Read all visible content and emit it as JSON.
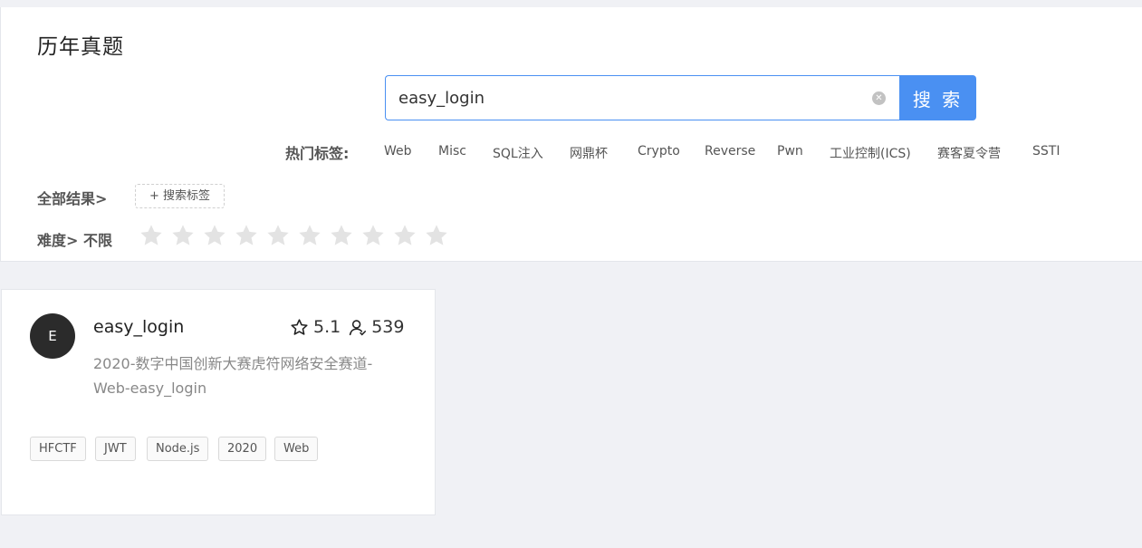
{
  "page": {
    "title": "历年真题"
  },
  "search": {
    "value": "easy_login",
    "button_label": "搜 索"
  },
  "hot_tags": {
    "label": "热门标签:",
    "items": [
      "Web",
      "Misc",
      "SQL注入",
      "网鼎杯",
      "Crypto",
      "Reverse",
      "Pwn",
      "工业控制(ICS)",
      "赛客夏令营",
      "SSTI"
    ]
  },
  "filters": {
    "all_results_label": "全部结果>",
    "add_tag_label": "+ 搜索标签",
    "difficulty_label": "难度> 不限",
    "difficulty_stars": 10,
    "difficulty_selected": 0
  },
  "results": [
    {
      "avatar_letter": "E",
      "title": "easy_login",
      "rating": "5.1",
      "solves": "539",
      "description": "2020-数字中国创新大赛虎符网络安全赛道-Web-easy_login",
      "tags": [
        "HFCTF",
        "JWT",
        "Node.js",
        "2020",
        "Web"
      ]
    }
  ],
  "colors": {
    "accent": "#4a90f2",
    "star_empty": "#e3e3e3",
    "avatar_bg": "#2b2b2b"
  }
}
